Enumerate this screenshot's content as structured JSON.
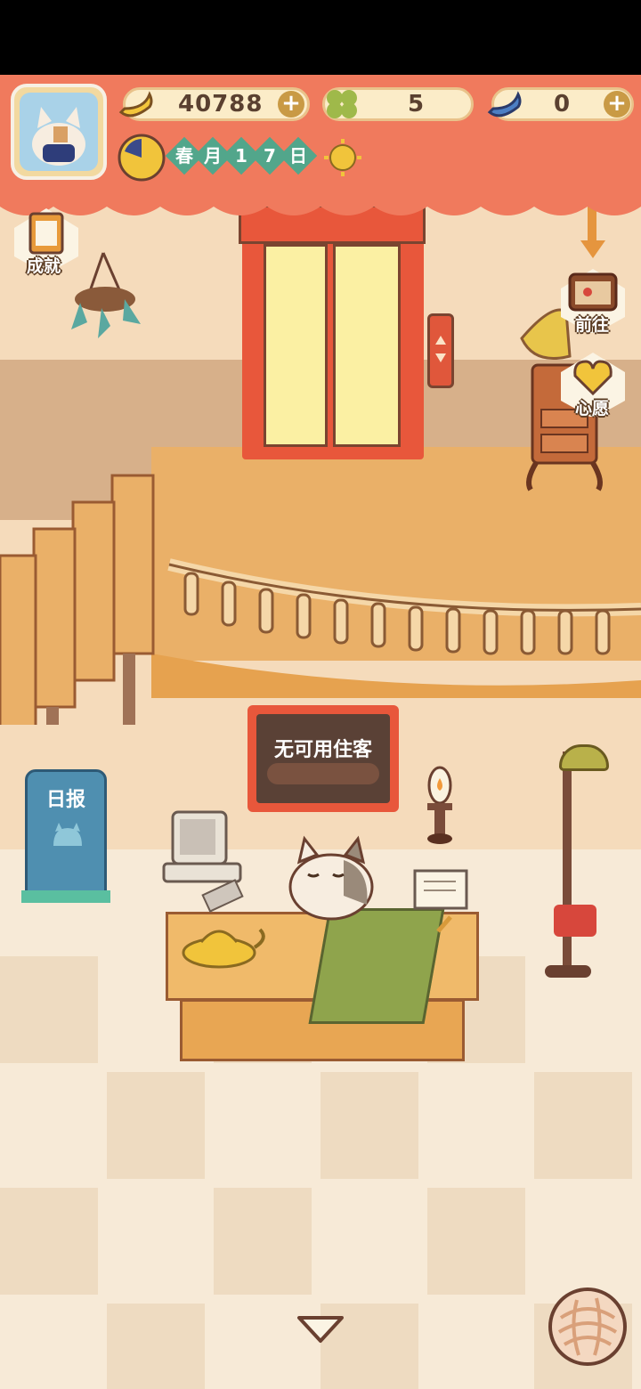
{
  "resources": {
    "banana": {
      "value": "40788",
      "icon": "banana-icon"
    },
    "clover": {
      "value": "5",
      "icon": "clover-icon"
    },
    "blue_banana": {
      "value": "0",
      "icon": "blue-banana-icon"
    }
  },
  "date": {
    "chars": [
      "春",
      "月",
      "1",
      "7",
      "日"
    ]
  },
  "side_buttons": {
    "achievements": "成就",
    "goto": "前往",
    "wish": "心愿"
  },
  "sign": {
    "text": "无可用住客"
  },
  "news_box": {
    "label": "日报"
  },
  "colors": {
    "header": "#f07a5d",
    "accent_green": "#52a68b",
    "elevator": "#e8573b"
  }
}
